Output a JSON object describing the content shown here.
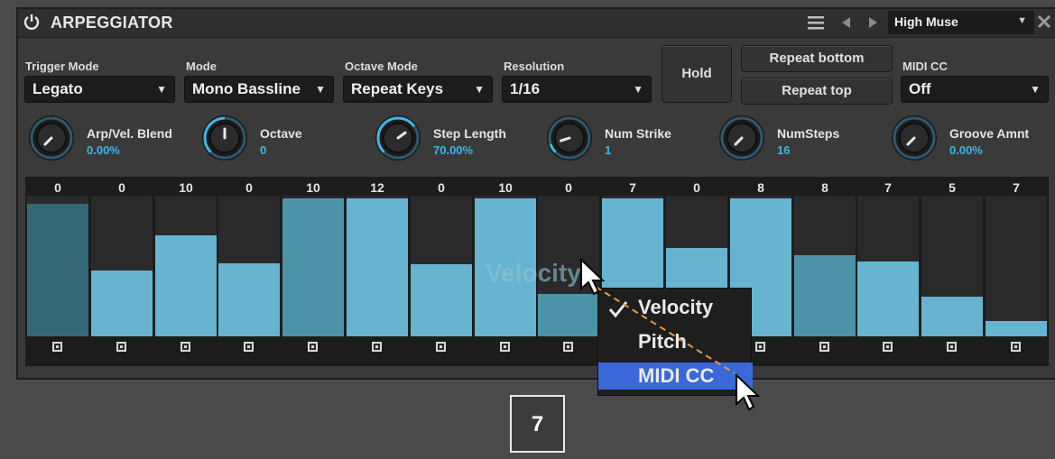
{
  "header": {
    "title": "ARPEGGIATOR",
    "preset": "High Muse"
  },
  "controls": {
    "trigger_mode": {
      "label": "Trigger Mode",
      "value": "Legato"
    },
    "mode": {
      "label": "Mode",
      "value": "Mono Bassline"
    },
    "octave_mode": {
      "label": "Octave Mode",
      "value": "Repeat Keys"
    },
    "resolution": {
      "label": "Resolution",
      "value": "1/16"
    },
    "hold_label": "Hold",
    "repeat_bottom_label": "Repeat bottom",
    "repeat_top_label": "Repeat top",
    "midi_cc": {
      "label": "MIDI CC",
      "value": "Off"
    }
  },
  "knobs": [
    {
      "label": "Arp/Vel. Blend",
      "value": "0.00%",
      "level": 0.0
    },
    {
      "label": "Octave",
      "value": "0",
      "level": 0.5
    },
    {
      "label": "Step Length",
      "value": "70.00%",
      "level": 0.7
    },
    {
      "label": "Num Strike",
      "value": "1",
      "level": 0.1
    },
    {
      "label": "NumSteps",
      "value": "16",
      "level": 0.0
    },
    {
      "label": "Groove Amnt",
      "value": "0.00%",
      "level": 0.0
    }
  ],
  "steps": {
    "labels": [
      "0",
      "0",
      "10",
      "0",
      "10",
      "12",
      "0",
      "10",
      "0",
      "7",
      "0",
      "8",
      "8",
      "7",
      "5",
      "7"
    ],
    "levels": [
      0.94,
      0.47,
      0.72,
      0.52,
      0.98,
      0.98,
      0.51,
      0.98,
      0.3,
      0.98,
      0.63,
      0.98,
      0.58,
      0.53,
      0.28,
      0.11
    ],
    "colors": [
      "#356875",
      "#66b4cf",
      "#66b4cf",
      "#66b4cf",
      "#4d93a8",
      "#66b4cf",
      "#66b4cf",
      "#66b4cf",
      "#4d93a8",
      "#66b4cf",
      "#66b4cf",
      "#66b4cf",
      "#4d93a8",
      "#66b4cf",
      "#66b4cf",
      "#66b4cf"
    ],
    "watermark": "Velocity"
  },
  "menu": {
    "items": [
      "Velocity",
      "Pitch",
      "MIDI CC"
    ],
    "checked": "Velocity",
    "selected": "MIDI CC"
  },
  "badge": "7",
  "colors": {
    "accent": "#3cb6e8",
    "bar": "#66b4cf",
    "menu_highlight": "#3a68d8"
  }
}
